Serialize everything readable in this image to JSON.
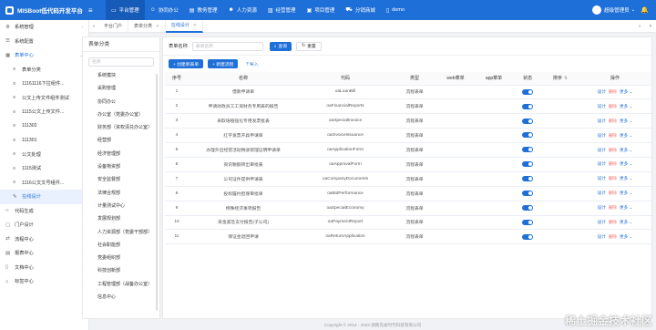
{
  "header": {
    "brand": "MISBoot低代码开发平台",
    "nav": [
      {
        "label": "平台管理",
        "icon": "monitor-icon",
        "active": true
      },
      {
        "label": "协同办公",
        "icon": "people-icon",
        "active": false
      },
      {
        "label": "教务管理",
        "icon": "book-icon",
        "active": false
      },
      {
        "label": "人力资源",
        "icon": "user-icon",
        "active": false
      },
      {
        "label": "经营管理",
        "icon": "chart-icon",
        "active": false
      },
      {
        "label": "项目管理",
        "icon": "folder-icon",
        "active": false
      },
      {
        "label": "分销商城",
        "icon": "cart-icon",
        "active": false
      },
      {
        "label": "demo",
        "icon": "doc-icon",
        "active": false
      }
    ],
    "user": "超级管理员"
  },
  "sidebar": {
    "items": [
      {
        "label": "系统管理",
        "icon": "gear-icon",
        "arrow": "›",
        "type": "top"
      },
      {
        "label": "系统配置",
        "icon": "sliders-icon",
        "arrow": "›",
        "type": "top"
      },
      {
        "label": "表单中心",
        "icon": "form-icon",
        "arrow": "⌄",
        "type": "open"
      },
      {
        "label": "表单分类",
        "icon": "list-icon",
        "type": "sub"
      },
      {
        "label": "11161116下拉组件...",
        "icon": "list-icon",
        "type": "sub"
      },
      {
        "label": "公文上传文件组件测试",
        "icon": "list-icon",
        "type": "sub"
      },
      {
        "label": "1115公文上传文件...",
        "icon": "list-icon",
        "type": "sub"
      },
      {
        "label": "111302",
        "icon": "list-icon",
        "type": "sub"
      },
      {
        "label": "111301",
        "icon": "list-icon",
        "type": "sub"
      },
      {
        "label": "公文处理",
        "icon": "list-icon",
        "type": "sub"
      },
      {
        "label": "1115测试",
        "icon": "list-icon",
        "type": "sub"
      },
      {
        "label": "1116公文文号组件...",
        "icon": "list-icon",
        "type": "sub"
      },
      {
        "label": "在线设计",
        "icon": "pencil-icon",
        "type": "active"
      },
      {
        "label": "代码生成",
        "icon": "code-icon",
        "arrow": "›",
        "type": "top"
      },
      {
        "label": "门户设计",
        "icon": "layout-icon",
        "arrow": "›",
        "type": "top"
      },
      {
        "label": "流程中心",
        "icon": "flow-icon",
        "arrow": "›",
        "type": "top"
      },
      {
        "label": "报表中心",
        "icon": "report-icon",
        "arrow": "›",
        "type": "top"
      },
      {
        "label": "文档中心",
        "icon": "file-icon",
        "arrow": "›",
        "type": "top"
      },
      {
        "label": "标签中心",
        "icon": "tag-icon",
        "arrow": "›",
        "type": "top"
      }
    ]
  },
  "tabs": [
    {
      "label": "平台门户",
      "active": false,
      "closable": false
    },
    {
      "label": "表单分类",
      "active": false,
      "closable": true
    },
    {
      "label": "在线设计",
      "active": true,
      "closable": true
    }
  ],
  "category": {
    "title": "表单分类",
    "search_placeholder": "名称",
    "items": [
      "系统模块",
      "采购管理",
      "协同办公",
      "办公室（党委办公室）",
      "财务部（资权清兑办公室）",
      "经营部",
      "经济管理部",
      "设备物资部",
      "安全监督部",
      "法律合规部",
      "计量测试中心",
      "发展规划部",
      "人力资源部（党委干部部）",
      "社会职能部",
      "党委组织部",
      "科技创新部",
      "工程管理部（战备办公室）",
      "信息中心"
    ]
  },
  "filter": {
    "name_label": "表单名称",
    "name_placeholder": "表单名称",
    "query_label": "查询",
    "reset_label": "重置"
  },
  "toolbar": {
    "create_form": "+ 创建新表单",
    "create_flow": "+ 新建流程",
    "import": "导入"
  },
  "table": {
    "headers": [
      "序号",
      "名称",
      "代码",
      "类型",
      "web菜单",
      "app菜单",
      "状态",
      "排序",
      "操作"
    ],
    "sort_arrows": "⇅",
    "ops": {
      "design": "设计",
      "delete": "删除",
      "more": "更多 ⌄"
    },
    "rows": [
      {
        "no": "1",
        "name": "借款申请单",
        "code": "oaLoanBill",
        "type": "流程表单"
      },
      {
        "no": "2",
        "name": "申请财政员工工资财务专用表的报告",
        "code": "oaFinancialReports",
        "type": "流程表单"
      },
      {
        "no": "3",
        "name": "采取培植强化专用发票批表",
        "code": "oaSpecialInvoice",
        "type": "流程表单"
      },
      {
        "no": "4",
        "name": "红字发票开具申请单",
        "code": "oaInvoiceIssuance",
        "type": "流程表单"
      },
      {
        "no": "5",
        "name": "办理外出经营活动税收管理证明申请单",
        "code": "oaApplicationForm",
        "type": "流程表单"
      },
      {
        "no": "6",
        "name": "资讯税额转出审批表",
        "code": "oaApprovalForm",
        "type": "流程表单"
      },
      {
        "no": "7",
        "name": "公司证件提供申请表",
        "code": "oaCompanyDocuments",
        "type": "流程表单"
      },
      {
        "no": "8",
        "name": "投标履约担保审批单",
        "code": "oaBidPerformance",
        "type": "流程表单"
      },
      {
        "no": "9",
        "name": "特殊经济事项报告",
        "code": "oaSpecialEconomy",
        "type": "流程表单"
      },
      {
        "no": "10",
        "name": "资金紧急支付报告(子公司)",
        "code": "oaPaymentReport",
        "type": "流程表单"
      },
      {
        "no": "11",
        "name": "保证金退回申请",
        "code": "oaReturnApplication",
        "type": "流程表单"
      }
    ]
  },
  "footer": {
    "copyright": "Copyright © 2014 - 2023 湖南先省时代科技有限公司"
  },
  "watermark": "稀土掘金技术社区"
}
